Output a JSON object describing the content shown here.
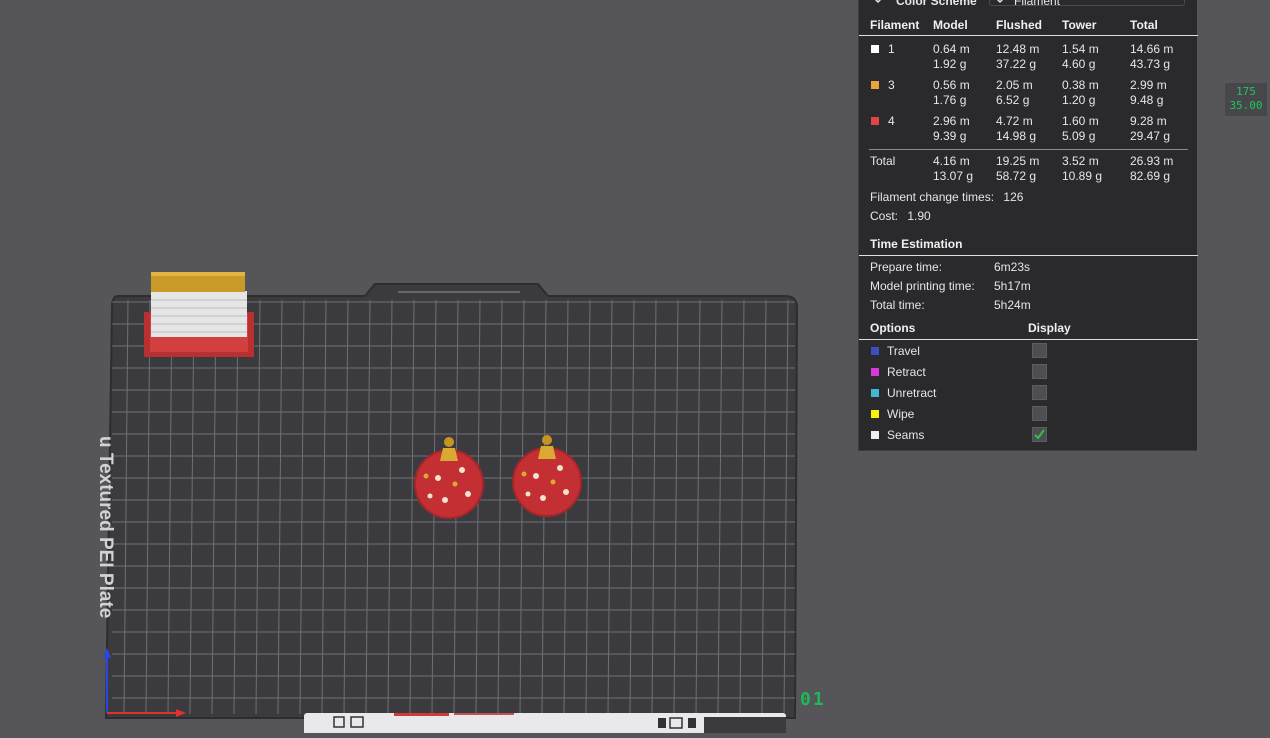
{
  "colors": {
    "filament_1": "#ffffff",
    "filament_3": "#e8a43c",
    "filament_4": "#e04545",
    "travel": "#3c4fc0",
    "retract": "#d63bd6",
    "unretract": "#43b4d6",
    "wipe": "#f5f20e",
    "seams": "#eeeeee",
    "check": "#2ec24e"
  },
  "color_scheme": {
    "label": "Color Scheme",
    "value": "Filament"
  },
  "filament_table": {
    "headers": [
      "Filament",
      "Model",
      "Flushed",
      "Tower",
      "Total"
    ],
    "rows": [
      {
        "id": "1",
        "model": "0.64 m\n1.92 g",
        "flushed": "12.48 m\n37.22 g",
        "tower": "1.54 m\n4.60 g",
        "total": "14.66 m\n43.73 g"
      },
      {
        "id": "3",
        "model": "0.56 m\n1.76 g",
        "flushed": "2.05 m\n6.52 g",
        "tower": "0.38 m\n1.20 g",
        "total": "2.99 m\n9.48 g"
      },
      {
        "id": "4",
        "model": "2.96 m\n9.39 g",
        "flushed": "4.72 m\n14.98 g",
        "tower": "1.60 m\n5.09 g",
        "total": "9.28 m\n29.47 g"
      }
    ],
    "total_row": {
      "label": "Total",
      "model": "4.16 m\n13.07 g",
      "flushed": "19.25 m\n58.72 g",
      "tower": "3.52 m\n10.89 g",
      "total": "26.93 m\n82.69 g"
    }
  },
  "filament_change": {
    "label": "Filament change times:",
    "value": "126"
  },
  "cost": {
    "label": "Cost:",
    "value": "1.90"
  },
  "time_estimation": {
    "title": "Time Estimation",
    "prepare": {
      "label": "Prepare time:",
      "value": "6m23s"
    },
    "model_printing": {
      "label": "Model printing time:",
      "value": "5h17m"
    },
    "total": {
      "label": "Total time:",
      "value": "5h24m"
    }
  },
  "options": {
    "title": "Options",
    "display_title": "Display",
    "items": [
      {
        "label": "Travel",
        "checked": false
      },
      {
        "label": "Retract",
        "checked": false
      },
      {
        "label": "Unretract",
        "checked": false
      },
      {
        "label": "Wipe",
        "checked": false
      },
      {
        "label": "Seams",
        "checked": true
      }
    ]
  },
  "ruler": {
    "top": "175",
    "bottom": "35.00"
  },
  "plate": {
    "number": "01",
    "label": "u Textured PEI Plate"
  }
}
